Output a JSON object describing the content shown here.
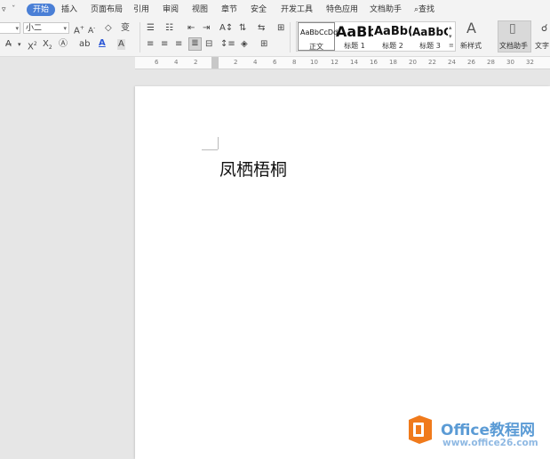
{
  "menu": {
    "tabs": [
      "开始",
      "插入",
      "页面布局",
      "引用",
      "审阅",
      "视图",
      "章节",
      "安全",
      "开发工具",
      "特色应用",
      "文档助手"
    ],
    "search_label": "查找"
  },
  "ribbon": {
    "font_size": "小二",
    "styles": [
      {
        "sample": "AaBbCcDd",
        "name": "正文"
      },
      {
        "sample": "AaBb",
        "name": "标题 1"
      },
      {
        "sample": "AaBb(",
        "name": "标题 2"
      },
      {
        "sample": "AaBbC",
        "name": "标题 3"
      }
    ],
    "new_style_label": "新样式",
    "doc_assistant_label": "文档助手",
    "text_tool_label": "文字"
  },
  "ruler": {
    "ticks": [
      "6",
      "4",
      "2",
      "2",
      "4",
      "6",
      "8",
      "10",
      "12",
      "14",
      "16",
      "18",
      "20",
      "22",
      "24",
      "26",
      "28",
      "30",
      "32"
    ]
  },
  "document": {
    "text": "凤栖梧桐"
  },
  "watermark": {
    "name": "Office教程网",
    "url": "www.office26.com"
  },
  "colors": {
    "accent": "#4a7fd6",
    "font_color": "#2b57d6",
    "watermark_orange": "#f07a1b",
    "watermark_blue": "#5b9bd5"
  }
}
